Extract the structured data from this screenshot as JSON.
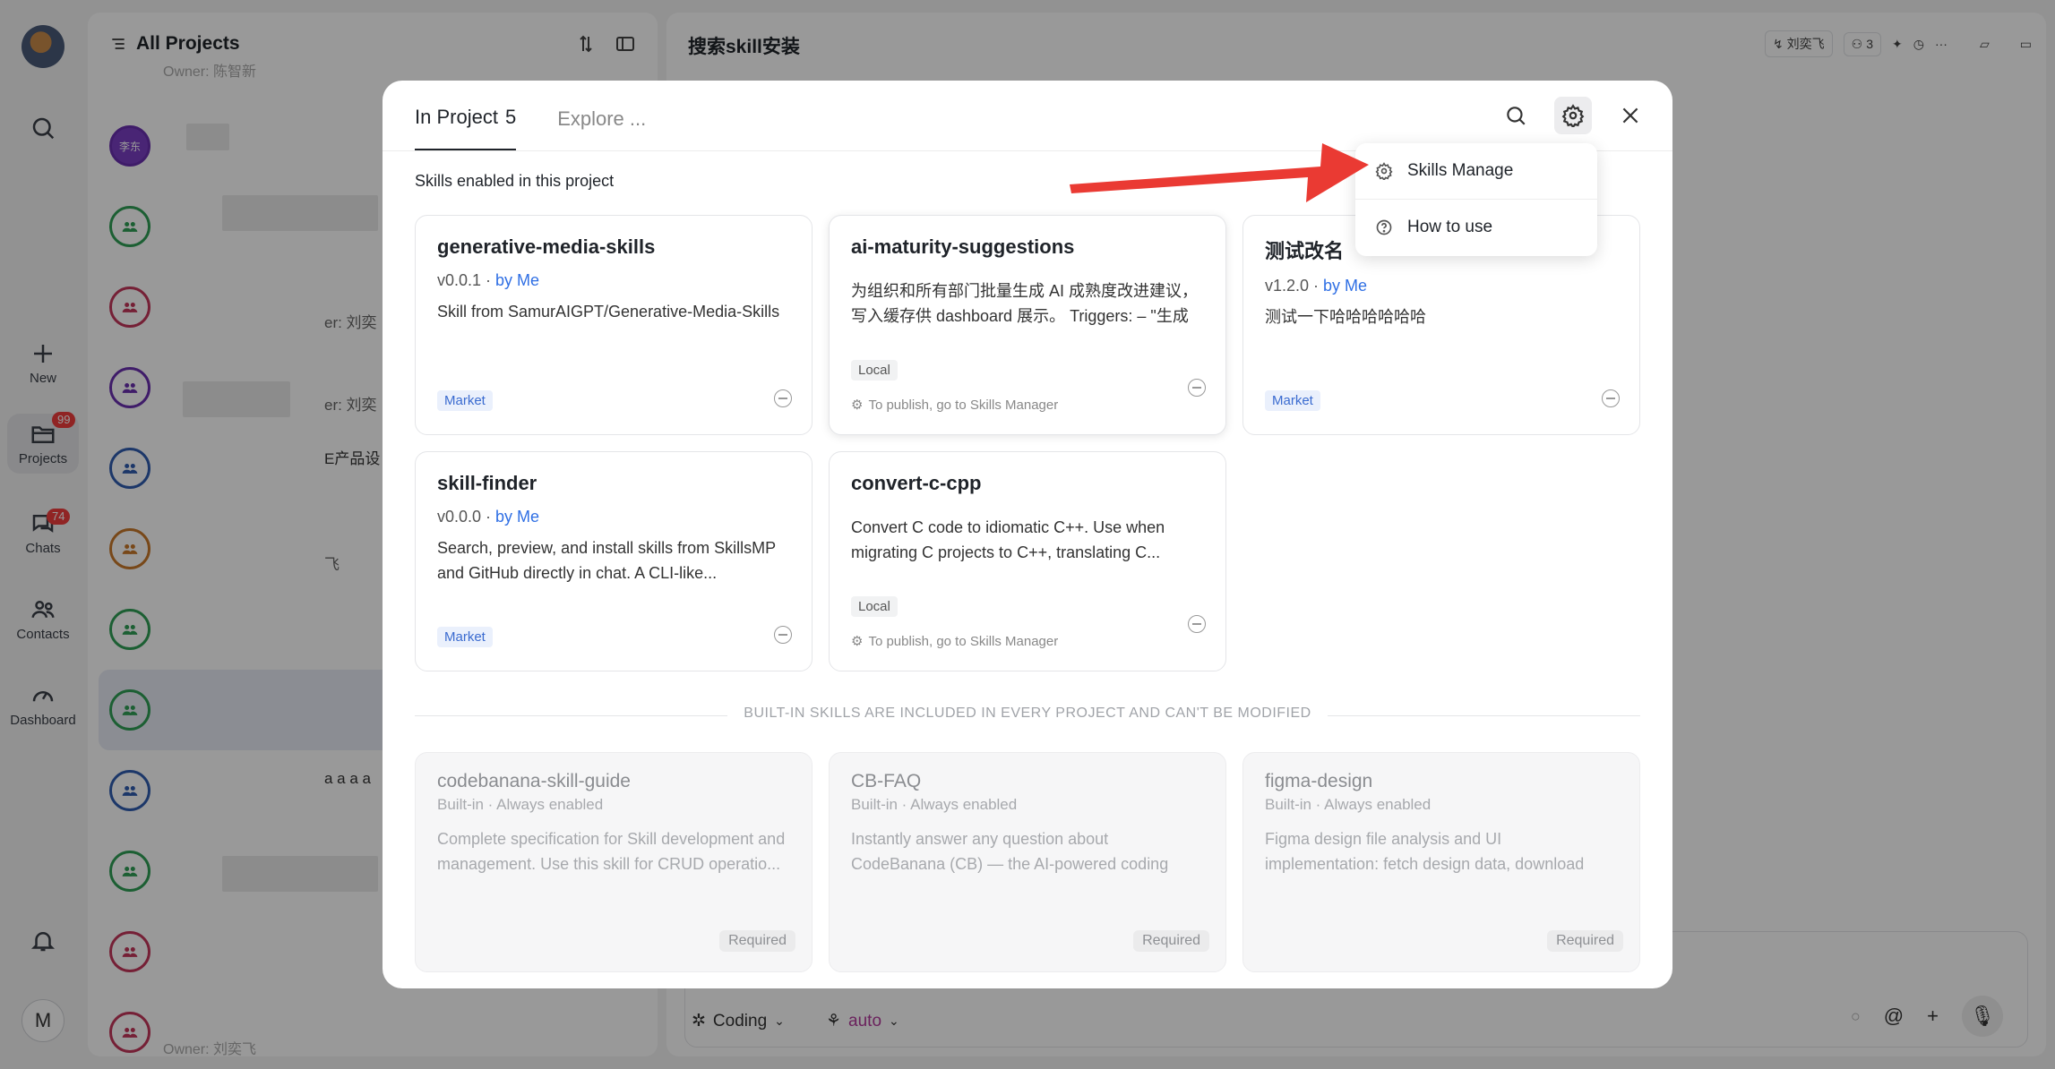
{
  "rail": {
    "new_label": "New",
    "projects_label": "Projects",
    "projects_badge": "99",
    "chats_label": "Chats",
    "chats_badge": "74",
    "contacts_label": "Contacts",
    "dashboard_label": "Dashboard",
    "user_initial": "M"
  },
  "project_list": {
    "title": "All Projects",
    "top_owner": "Owner: 陈智新",
    "avatar_text": "李东",
    "fragments": [
      "er: 刘奕",
      "er: 刘奕",
      "E产品设",
      "飞",
      "a a a a"
    ],
    "bottom_owner": "Owner: 刘奕飞"
  },
  "chat": {
    "title": "搜索skill安装",
    "owner_chip": "刘奕飞",
    "members_count": "3",
    "mode_label": "Coding",
    "model_label": "auto"
  },
  "modal": {
    "tab_in_project": "In Project",
    "tab_in_project_count": "5",
    "tab_explore": "Explore ...",
    "subtitle": "Skills enabled in this project",
    "menu": {
      "skills_manage": "Skills Manage",
      "how_to_use": "How to use"
    },
    "publish_hint": "To publish, go to Skills Manager",
    "skills": [
      {
        "name": "generative-media-skills",
        "version": "v0.0.1",
        "by": "by Me",
        "desc": "Skill from SamurAIGPT/Generative-Media-Skills",
        "tag": "Market"
      },
      {
        "name": "ai-maturity-suggestions",
        "version": "",
        "by": "",
        "desc": "为组织和所有部门批量生成 AI 成熟度改进建议，写入缓存供 dashboard 展示。 Triggers: – \"生成 A...",
        "tag": "Local"
      },
      {
        "name": "测试改名",
        "version": "v1.2.0",
        "by": "by Me",
        "desc": "测试一下哈哈哈哈哈哈",
        "tag": "Market"
      },
      {
        "name": "skill-finder",
        "version": "v0.0.0",
        "by": "by Me",
        "desc": "Search, preview, and install skills from SkillsMP and GitHub directly in chat. A CLI-like...",
        "tag": "Market"
      },
      {
        "name": "convert-c-cpp",
        "version": "",
        "by": "",
        "desc": "Convert C code to idiomatic C++. Use when migrating C projects to C++, translating C...",
        "tag": "Local"
      }
    ],
    "builtin_heading": "BUILT-IN SKILLS ARE INCLUDED IN EVERY PROJECT AND CAN'T BE MODIFIED",
    "builtin_sub": "Built-in · Always enabled",
    "required_label": "Required",
    "builtin": [
      {
        "name": "codebanana-skill-guide",
        "desc": "Complete specification for Skill development and management. Use this skill for CRUD operatio..."
      },
      {
        "name": "CB-FAQ",
        "desc": "Instantly answer any question about CodeBanana (CB) — the AI-powered coding assistant..."
      },
      {
        "name": "figma-design",
        "desc": "Figma design file analysis and UI implementation: fetch design data, download assets, generate..."
      }
    ]
  },
  "colors": {
    "accent_link": "#2f6fe4",
    "arrow_red": "#ea3a33",
    "badge_red": "#f03d3d"
  }
}
